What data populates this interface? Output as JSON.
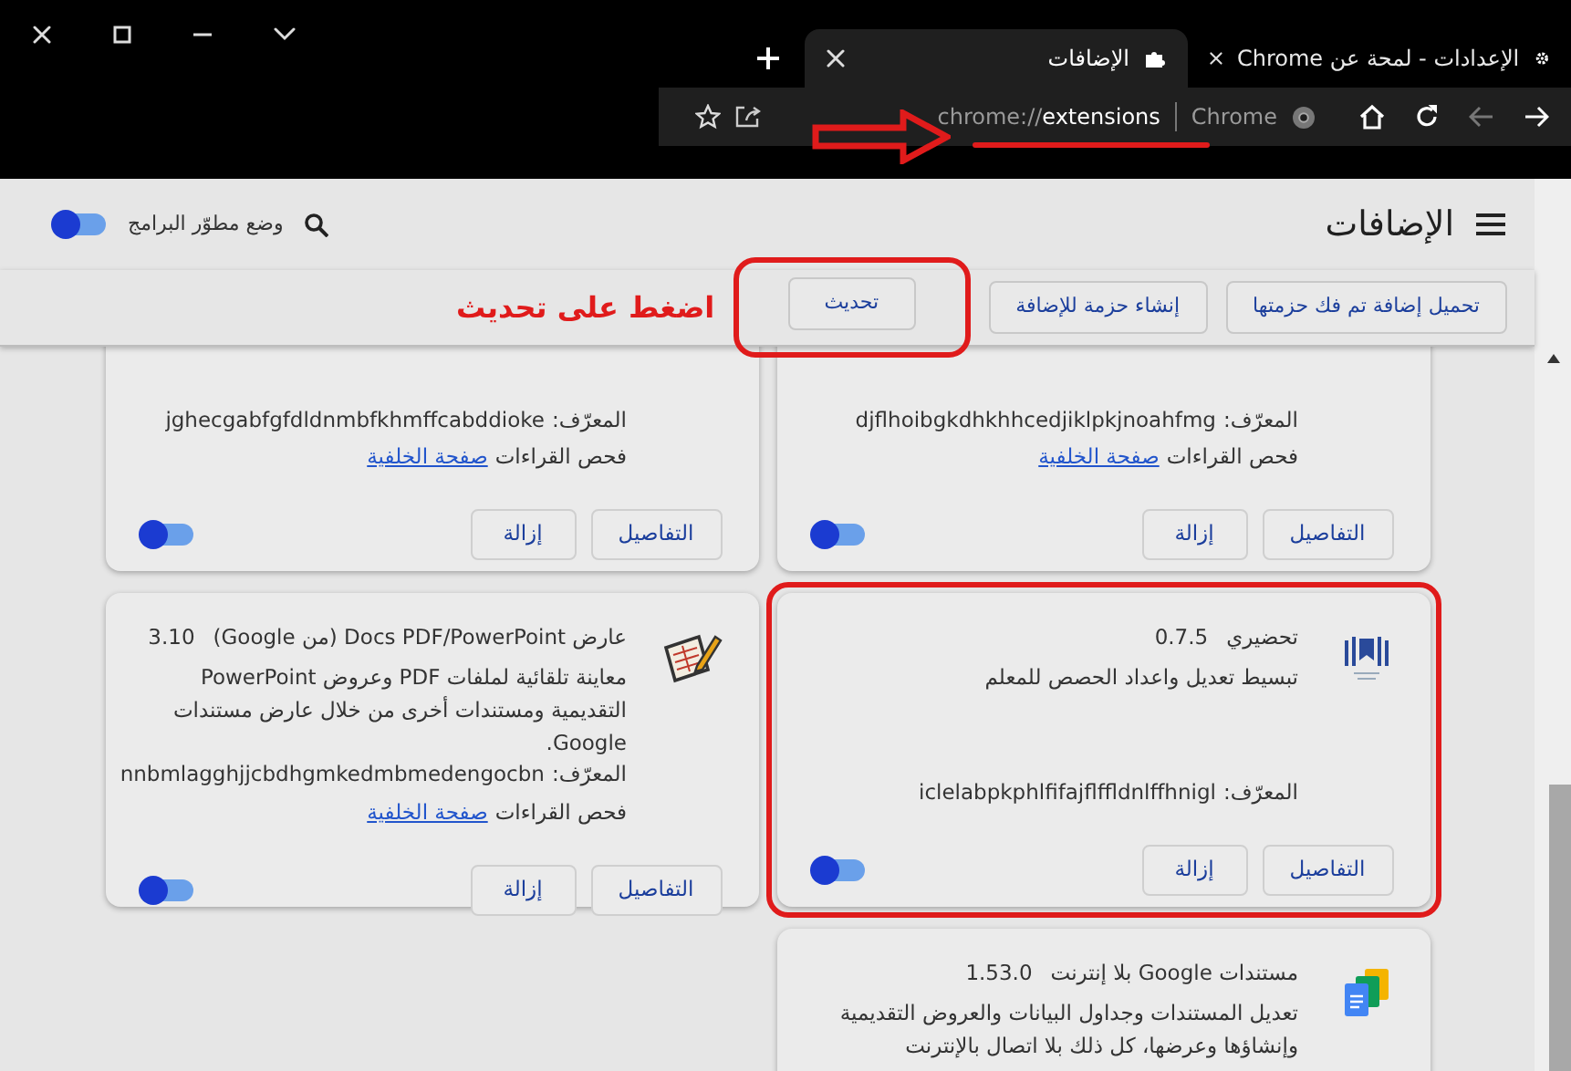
{
  "tabs": [
    {
      "title": "الإعدادات - لمحة عن Chrome",
      "selected": false
    },
    {
      "title": "الإضافات",
      "selected": true
    }
  ],
  "address_bar": {
    "site_label": "Chrome",
    "url_scheme": "chrome://",
    "url_path": "extensions"
  },
  "header": {
    "title": "الإضافات",
    "developer_mode": {
      "label": "وضع مطوّر البرامج",
      "on": true
    }
  },
  "actions": [
    {
      "label": "تحميل إضافة تم فك حزمتها",
      "highlighted": false
    },
    {
      "label": "إنشاء حزمة للإضافة",
      "highlighted": false
    },
    {
      "label": "تحديث",
      "highlighted": true
    }
  ],
  "annotation_text": "اضغط على تحديث",
  "extensions": [
    {
      "id_label": "المعرّف:",
      "id": "djflhoibgkdhkhhcedjiklpkjnoahfmg",
      "inspect_label": "فحص القراءات",
      "inspect_link": "صفحة الخلفية",
      "details_button": "التفاصيل",
      "remove_button": "إزالة",
      "enabled": true,
      "highlighted": false
    },
    {
      "id_label": "المعرّف:",
      "id": "jghecgabfgfdldnmbfkhmffcabddioke",
      "inspect_label": "فحص القراءات",
      "inspect_link": "صفحة الخلفية",
      "details_button": "التفاصيل",
      "remove_button": "إزالة",
      "enabled": true,
      "highlighted": false
    },
    {
      "kind": "book",
      "name": "تحضيري",
      "version": "0.7.5",
      "description": "تبسيط تعديل واعداد الحصص للمعلم",
      "id_label": "المعرّف:",
      "id": "iclelabpkphlfifajflffldnlffhnigl",
      "details_button": "التفاصيل",
      "remove_button": "إزالة",
      "enabled": true,
      "highlighted": true
    },
    {
      "kind": "viewer",
      "name": "عارض Docs PDF/PowerPoint (من Google)",
      "version": "3.10",
      "description": "معاينة تلقائية لملفات PDF وعروض PowerPoint التقديمية ومستندات أخرى من خلال عارض مستندات Google.",
      "id_label": "المعرّف:",
      "id": "nnbmlagghjjcbdhgmkedmbmedengocbn",
      "inspect_label": "فحص القراءات",
      "inspect_link": "صفحة الخلفية",
      "details_button": "التفاصيل",
      "remove_button": "إزالة",
      "enabled": true,
      "highlighted": false
    },
    {
      "kind": "documents",
      "name": "مستندات Google بلا إنترنت",
      "version": "1.53.0",
      "description": "تعديل المستندات وجداول البيانات والعروض التقديمية وإنشاؤها وعرضها، كل ذلك بلا اتصال بالإنترنت",
      "highlighted": false
    }
  ]
}
